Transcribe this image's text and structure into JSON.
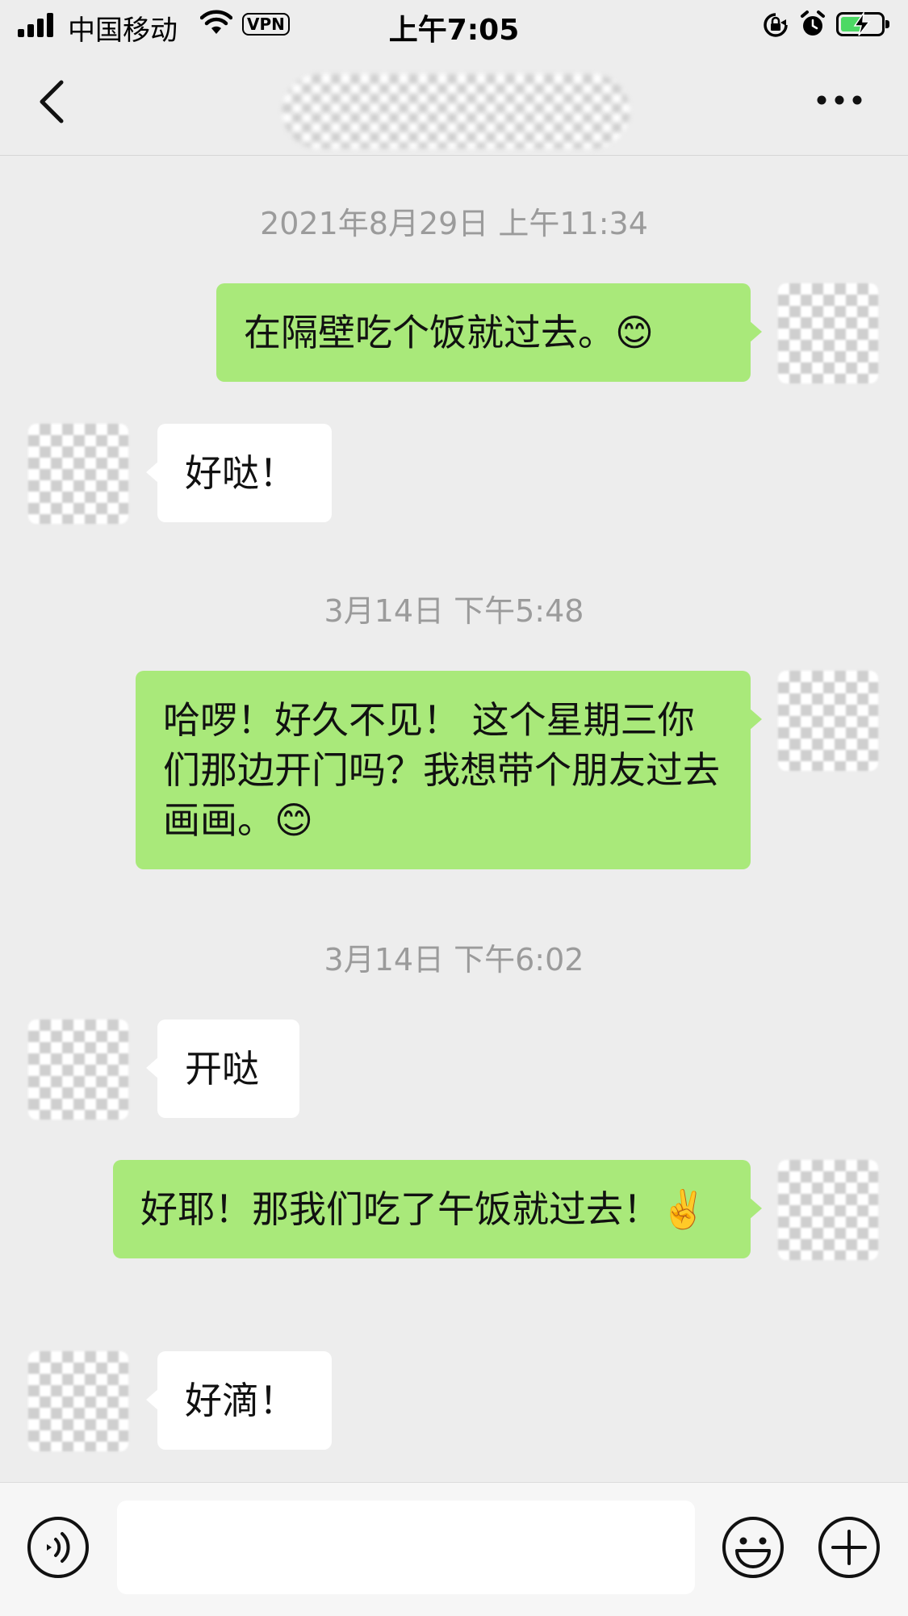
{
  "status_bar": {
    "carrier": "中国移动",
    "vpn": "VPN",
    "time": "上午7:05",
    "battery_level": 0.55,
    "battery_charging": true,
    "icons": [
      "signal-icon",
      "wifi-icon",
      "vpn-badge",
      "rotation-lock-icon",
      "alarm-icon",
      "battery-icon"
    ]
  },
  "nav": {
    "back_icon": "chevron-left-icon",
    "title_redacted": true,
    "more_icon": "more-dots-icon"
  },
  "colors": {
    "background": "#ededed",
    "my_bubble": "#a9e97a",
    "their_bubble": "#ffffff",
    "timestamp_text": "#9b9b9b"
  },
  "timestamps": {
    "t1": "2021年8月29日 上午11:34",
    "t2": "3月14日 下午5:48",
    "t3": "3月14日 下午6:02"
  },
  "messages": {
    "m1": "在隔壁吃个饭就过去。😊",
    "m2": "好哒！",
    "m3": "哈啰！好久不见！ 这个星期三你们那边开门吗？我想带个朋友过去画画。😊",
    "m4": "开哒",
    "m5": "好耶！那我们吃了午饭就过去！✌️",
    "m6": "好滴！"
  },
  "message_senders": [
    "me",
    "them",
    "me",
    "them",
    "me",
    "them"
  ],
  "input": {
    "value": "",
    "placeholder": "",
    "icons": [
      "voice-icon",
      "emoji-icon",
      "plus-icon"
    ]
  }
}
